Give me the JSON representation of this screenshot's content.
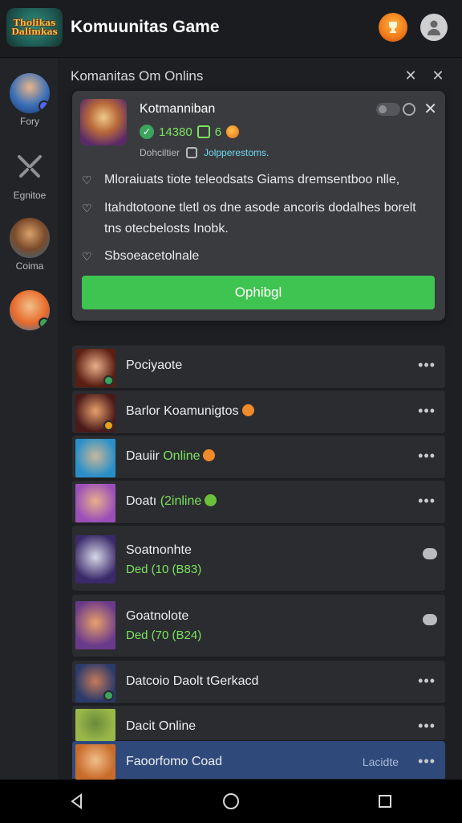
{
  "app": {
    "logo_text": "Tholikas Dalimkas",
    "title": "Komuunitas Game"
  },
  "sidebar": {
    "items": [
      {
        "label": "Fory"
      },
      {
        "label": "Egnitoe"
      },
      {
        "label": "Coima"
      },
      {
        "label": ""
      }
    ]
  },
  "panel": {
    "title": "Komanitas Om Onlins"
  },
  "card": {
    "name": "Kotmanniban",
    "score": "14380",
    "stat_b": "6",
    "sub_left": "Dohciltier",
    "sub_right": "Jolpperestoms.",
    "top_toggle_label": "00",
    "features": [
      "Mloraiuats tiote teleodsats Giams dremsentboo nlle,",
      "Itahdtotoone tletl os dne asode ancoris dodalhes borelt tns otecbelosts Inobk.",
      "Sbsoeacetolnale"
    ],
    "cta_label": "Ophibgl"
  },
  "list": [
    {
      "name": "Pociyaote",
      "name_green": "",
      "sub": "",
      "action": "more",
      "avatar_bg": "#5a1e12",
      "status": "#3ba55d"
    },
    {
      "name": "Barlor Koamunigtos",
      "name_green": "",
      "sub": "",
      "action": "more",
      "avatar_bg": "#4a1a1a",
      "status": "#e8a21a",
      "emoji": "#f08a2a"
    },
    {
      "name": "Dauiir ",
      "name_green": "Online",
      "sub": "",
      "action": "more",
      "avatar_bg": "#2a8fc8",
      "status": "",
      "emoji": "#f08a2a"
    },
    {
      "name": "Doatı ",
      "name_green": "(2inline",
      "sub": "",
      "action": "more",
      "avatar_bg": "#9a4fb8",
      "status": "",
      "emoji": "#6bbf3a"
    },
    {
      "name": "Soatnonhte",
      "name_green": "",
      "sub": "Ded (10 (B83)",
      "action": "chat",
      "avatar_bg": "#3a2a6a",
      "status": ""
    },
    {
      "name": "Goatnolote",
      "name_green": "",
      "sub": "Ded (70 (B24)",
      "action": "chat",
      "avatar_bg": "#6a3a8a",
      "status": ""
    },
    {
      "name": "Datcoio Daolt tGerkacd",
      "name_green": "",
      "sub": "",
      "action": "more",
      "avatar_bg": "#2a3a6a",
      "status": "#3ba55d"
    },
    {
      "name": "Dacit Online",
      "name_green": "",
      "sub": "",
      "action": "more",
      "avatar_bg": "#9ab84a",
      "status": ""
    },
    {
      "name": "Faoorfomo Coad",
      "name_green": "",
      "sub": "",
      "action": "more",
      "tag": "Lacidte",
      "avatar_bg": "#c86a2a",
      "status": "",
      "highlight": true
    }
  ],
  "colors": {
    "accent_green": "#3fc451",
    "online_green": "#7be35f",
    "highlight_row": "#2f4a7a"
  }
}
